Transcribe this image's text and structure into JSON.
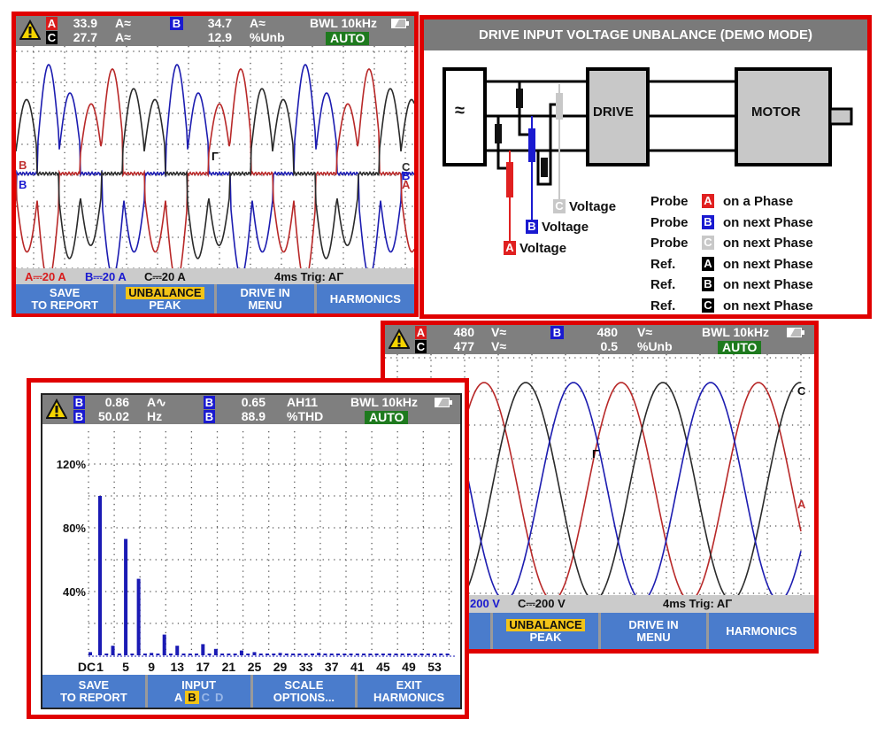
{
  "current_scope": {
    "header": {
      "ch1": "A",
      "ch2": "C",
      "v1": "33.9",
      "u1": "A≈",
      "v2": "27.7",
      "u2": "A≈",
      "chb": "B",
      "v3": "34.7",
      "u3": "A≈",
      "v4": "12.9",
      "u4": "%Unb",
      "bwl": "BWL 10kHz",
      "auto": "AUTO"
    },
    "markers": {
      "left_top": "B",
      "left_bottom": "B",
      "right_c": "C",
      "right_b": "B",
      "right_a": "A",
      "trigger": "Γ"
    },
    "status": {
      "a": "A⎓20 A",
      "b": "B⎓20 A",
      "c": "C⎓20 A",
      "trig": "4ms Trig: AΓ"
    },
    "menu": [
      {
        "l1": "SAVE",
        "l2": "TO REPORT"
      },
      {
        "l1": "UNBALANCE",
        "l2": "PEAK"
      },
      {
        "l1": "DRIVE IN",
        "l2": "MENU"
      },
      {
        "l1": "HARMONICS",
        "l2": ""
      }
    ]
  },
  "diagram": {
    "title": "DRIVE INPUT VOLTAGE UNBALANCE (DEMO MODE)",
    "source_symbol": "≈",
    "drive": "DRIVE",
    "motor": "MOTOR",
    "probe_labels": [
      {
        "badge": "C",
        "text": "Voltage"
      },
      {
        "badge": "B",
        "text": "Voltage"
      },
      {
        "badge": "A",
        "text": "Voltage"
      }
    ],
    "legend": [
      {
        "kind": "Probe",
        "badge": "A",
        "text": "on a Phase"
      },
      {
        "kind": "Probe",
        "badge": "B",
        "text": "on next Phase"
      },
      {
        "kind": "Probe",
        "badge": "C",
        "text": "on next Phase"
      },
      {
        "kind": "Ref.",
        "badge": "A",
        "text": "on next Phase"
      },
      {
        "kind": "Ref.",
        "badge": "B",
        "text": "on next Phase"
      },
      {
        "kind": "Ref.",
        "badge": "C",
        "text": "on next Phase"
      }
    ],
    "colors": {
      "A": "#e02020",
      "B": "#1a1ad0",
      "C": "#c8c8c8",
      "ref": "#000000"
    }
  },
  "voltage_scope": {
    "header": {
      "ch1": "A",
      "ch2": "C",
      "v1": "480",
      "u1": "V≈",
      "v2": "477",
      "u2": "V≈",
      "chb": "B",
      "v3": "480",
      "u3": "V≈",
      "v4": "0.5",
      "u4": "%Unb",
      "bwl": "BWL 10kHz",
      "auto": "AUTO"
    },
    "markers": {
      "c": "C",
      "a": "A",
      "trigger": "Γ"
    },
    "status": {
      "b": "200 V",
      "c": "C⎓200 V",
      "trig": "4ms Trig: AΓ"
    },
    "menu": [
      {
        "l1": "",
        "l2": ""
      },
      {
        "l1": "UNBALANCE",
        "l2": "PEAK"
      },
      {
        "l1": "DRIVE IN",
        "l2": "MENU"
      },
      {
        "l1": "HARMONICS",
        "l2": ""
      }
    ]
  },
  "harmonics_scope": {
    "header": {
      "ch1": "B",
      "ch2": "B",
      "v1": "0.86",
      "u1": "A∿",
      "v2": "50.02",
      "u2": "Hz",
      "chb1": "B",
      "chb2": "B",
      "v3": "0.65",
      "u3": "AH11",
      "v4": "88.9",
      "u4": "%THD",
      "bwl": "BWL 10kHz",
      "auto": "AUTO"
    },
    "menu": [
      {
        "l1": "SAVE",
        "l2": "TO REPORT"
      },
      {
        "l1": "INPUT",
        "opts": [
          "A",
          "B",
          "C",
          "D"
        ],
        "selected": "B"
      },
      {
        "l1": "SCALE",
        "l2": "OPTIONS..."
      },
      {
        "l1": "EXIT",
        "l2": "HARMONICS"
      }
    ]
  },
  "chart_data": {
    "type": "bar",
    "ylabel_ticks": [
      "40%",
      "80%",
      "120%"
    ],
    "ylim": [
      0,
      130
    ],
    "x_tick_labels": [
      "DC",
      "1",
      "5",
      "9",
      "13",
      "17",
      "21",
      "25",
      "29",
      "33",
      "37",
      "41",
      "45",
      "49",
      "53"
    ],
    "dc": 2,
    "harmonics": [
      1,
      2,
      3,
      4,
      5,
      6,
      7,
      8,
      9,
      10,
      11,
      12,
      13,
      14,
      15,
      16,
      17,
      18,
      19,
      20,
      21,
      22,
      23,
      24,
      25,
      26,
      27,
      28,
      29,
      30,
      31,
      32,
      33,
      34,
      35,
      36,
      37,
      38,
      39,
      40,
      41,
      42,
      43,
      44,
      45,
      46,
      47,
      48,
      49,
      50,
      51,
      52,
      53,
      54,
      55
    ],
    "values": [
      100,
      1,
      6,
      1,
      73,
      1,
      48,
      1,
      1.5,
      0.5,
      13,
      0.5,
      6,
      1,
      1,
      0.5,
      7,
      0.5,
      4,
      0.5,
      1,
      1,
      3,
      0.5,
      2,
      1,
      1,
      0.5,
      1.5,
      0.5,
      1,
      0.5,
      1,
      0.5,
      1.5,
      0.5,
      1,
      0.5,
      0.5,
      0.5,
      1,
      0.5,
      1,
      0.5,
      0.5,
      0.5,
      1,
      0.5,
      1,
      0.5,
      0.5,
      0.5,
      1,
      0.5,
      1
    ],
    "bar_color": "#1a1ab4",
    "grid": true
  }
}
